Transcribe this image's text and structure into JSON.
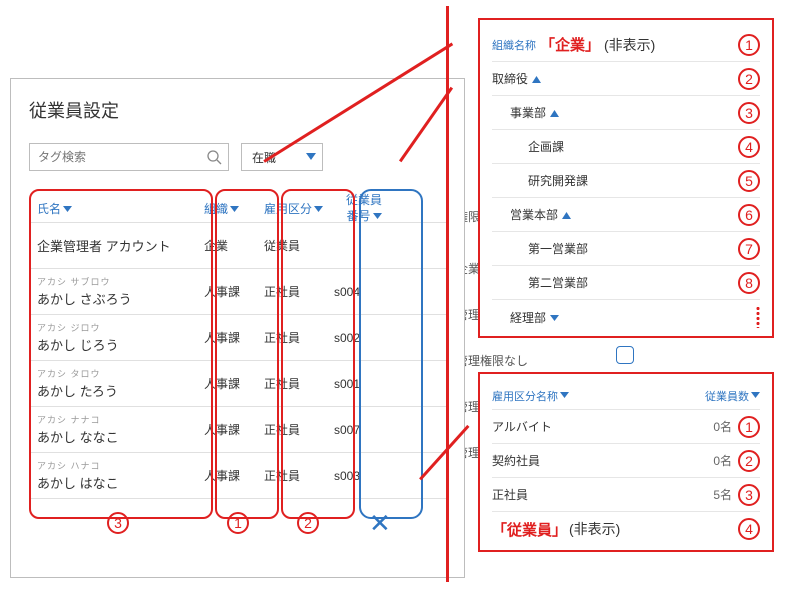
{
  "main": {
    "title": "従業員設定",
    "search_placeholder": "タグ検索",
    "status_selected": "在職",
    "columns": {
      "name": "氏名",
      "org": "組織",
      "emp_type": "雇用区分",
      "emp_no_l1": "従業員",
      "emp_no_l2": "番号"
    },
    "rows": [
      {
        "kana": "",
        "name": "企業管理者 アカウント",
        "org": "企業",
        "emp": "従業員",
        "num": ""
      },
      {
        "kana": "アカシ サブロウ",
        "name": "あかし さぶろう",
        "org": "人事課",
        "emp": "正社員",
        "num": "s004"
      },
      {
        "kana": "アカシ ジロウ",
        "name": "あかし じろう",
        "org": "人事課",
        "emp": "正社員",
        "num": "s002"
      },
      {
        "kana": "アカシ タロウ",
        "name": "あかし たろう",
        "org": "人事課",
        "emp": "正社員",
        "num": "s001"
      },
      {
        "kana": "アカシ ナナコ",
        "name": "あかし ななこ",
        "org": "人事課",
        "emp": "正社員",
        "num": "s007"
      },
      {
        "kana": "アカシ ハナコ",
        "name": "あかし はなこ",
        "org": "人事課",
        "emp": "正社員",
        "num": "s003"
      }
    ],
    "bottom_annot": {
      "c3": "3",
      "c1": "1",
      "c2": "2"
    }
  },
  "ghost_texts": {
    "g1": "権限",
    "g2": "企業",
    "g3": "管理",
    "g4": "管理権限なし",
    "g5": "管理",
    "g6": "管理"
  },
  "org_panel": {
    "header": "組織名称",
    "header_annot_bold": "「企業」",
    "header_annot_note": "(非表示)",
    "items": [
      {
        "label": "取締役",
        "indent": 0,
        "caret": "up",
        "num": "2"
      },
      {
        "label": "事業部",
        "indent": 1,
        "caret": "up",
        "num": "3"
      },
      {
        "label": "企画課",
        "indent": 2,
        "caret": "",
        "num": "4"
      },
      {
        "label": "研究開発課",
        "indent": 2,
        "caret": "",
        "num": "5"
      },
      {
        "label": "営業本部",
        "indent": 1,
        "caret": "up",
        "num": "6"
      },
      {
        "label": "第一営業部",
        "indent": 2,
        "caret": "",
        "num": "7"
      },
      {
        "label": "第二営業部",
        "indent": 2,
        "caret": "",
        "num": "8"
      },
      {
        "label": "経理部",
        "indent": 1,
        "caret": "down",
        "num": ""
      }
    ],
    "header_num": "1"
  },
  "emp_panel": {
    "col_name": "雇用区分名称",
    "col_count": "従業員数",
    "rows": [
      {
        "label": "アルバイト",
        "count": "0名",
        "num": "1"
      },
      {
        "label": "契約社員",
        "count": "0名",
        "num": "2"
      },
      {
        "label": "正社員",
        "count": "5名",
        "num": "3"
      }
    ],
    "footer_bold": "「従業員」",
    "footer_note": "(非表示)",
    "footer_num": "4"
  }
}
